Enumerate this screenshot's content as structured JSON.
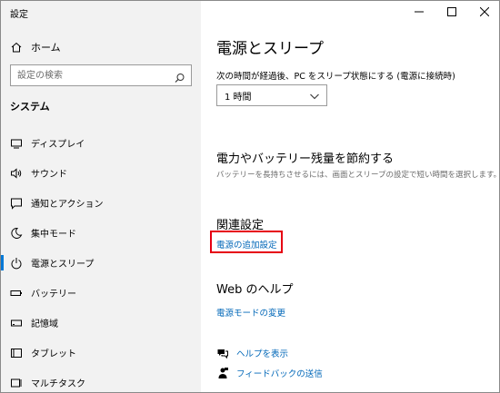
{
  "window": {
    "title": "設定"
  },
  "sidebar": {
    "home_label": "ホーム",
    "search_placeholder": "設定の検索",
    "section_label": "システム",
    "items": [
      {
        "label": "ディスプレイ",
        "icon": "monitor-icon"
      },
      {
        "label": "サウンド",
        "icon": "speaker-icon"
      },
      {
        "label": "通知とアクション",
        "icon": "notification-icon"
      },
      {
        "label": "集中モード",
        "icon": "moon-icon"
      },
      {
        "label": "電源とスリープ",
        "icon": "power-icon",
        "active": true
      },
      {
        "label": "バッテリー",
        "icon": "battery-icon"
      },
      {
        "label": "記憶域",
        "icon": "storage-icon"
      },
      {
        "label": "タブレット",
        "icon": "tablet-icon"
      },
      {
        "label": "マルチタスク",
        "icon": "multitask-icon"
      }
    ]
  },
  "main": {
    "title": "電源とスリープ",
    "sleep_label": "次の時間が経過後、PC をスリープ状態にする (電源に接続時)",
    "sleep_value": "1 時間",
    "save_heading": "電力やバッテリー残量を節約する",
    "save_desc": "バッテリーを長持ちさせるには、画面とスリープの設定で短い時間を選択します。",
    "related_heading": "関連設定",
    "related_link": "電源の追加設定",
    "web_help_heading": "Web のヘルプ",
    "web_help_link": "電源モードの変更",
    "help_link": "ヘルプを表示",
    "feedback_link": "フィードバックの送信"
  },
  "colors": {
    "accent": "#0078d7",
    "link": "#0067b8",
    "highlight": "#e60012",
    "sidebar_bg": "#f2f2f2"
  }
}
